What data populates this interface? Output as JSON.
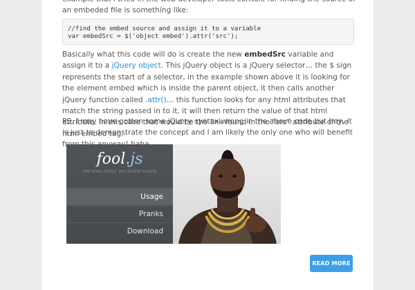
{
  "intro_text": "example that I tried in the web developer tools console for finding the source of an embeded file is something like:",
  "code": {
    "line1": "//find the embed source and assign it to a variable",
    "line2": "var embedSrc = $('object embed').attr('src');"
  },
  "paragraph2": {
    "t1": "Basically what this code will do is create the new ",
    "bold": "embedSrc",
    "t2": " variable and assign it to a ",
    "link1": "jQuery object",
    "t3": ". This jQuery object is a jQuery selector… the $ sign represents the start of a selector, in the example shown above it is looking for the element embed which is inside the parent object, it then calls another jQuery function called ",
    "link2": ".attr()",
    "t4": "… this function looks for any html attributes that match the string passed in to it, it will then return the value of that html attribute. In this case that would be the link found in the “src” attribute of the html embed tag."
  },
  "paragraph3": "PS. I may have gotten some jQuery syntax wrong in the above code but hey, it is just to demonstrate the concept and I am likely the only one who will benefit from this anyway! haha.",
  "figure": {
    "logo_main": "fool",
    "logo_ext": ".js",
    "tagline": "THE APRIL FOOLS' DAY JQUERY PLUGIN",
    "menu": [
      "Usage",
      "Pranks",
      "Download"
    ]
  },
  "read_more_label": "READ MORE",
  "colors": {
    "link": "#2b8fd6",
    "button": "#3d9fe8"
  }
}
